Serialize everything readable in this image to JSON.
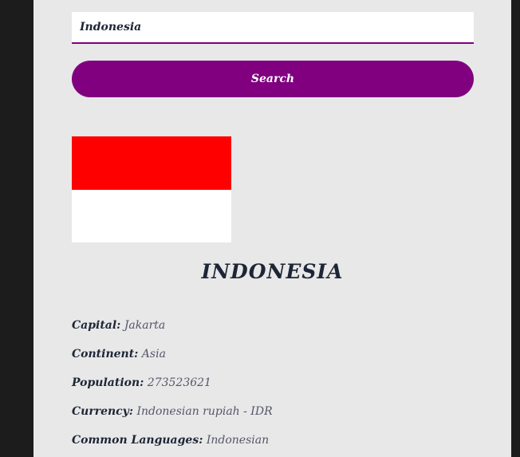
{
  "search": {
    "value": "Indonesia",
    "button_label": "Search"
  },
  "flag": {
    "top_color": "#ff0000",
    "bottom_color": "#ffffff"
  },
  "country": {
    "name": "INDONESIA"
  },
  "details": [
    {
      "label": "Capital:",
      "value": "Jakarta"
    },
    {
      "label": "Continent:",
      "value": "Asia"
    },
    {
      "label": "Population:",
      "value": "273523621"
    },
    {
      "label": "Currency:",
      "value": "Indonesian rupiah - IDR"
    },
    {
      "label": "Common Languages:",
      "value": "Indonesian"
    }
  ],
  "colors": {
    "accent": "#800080",
    "panel_bg": "#e8e8e8",
    "page_bg": "#1c1c1c"
  }
}
